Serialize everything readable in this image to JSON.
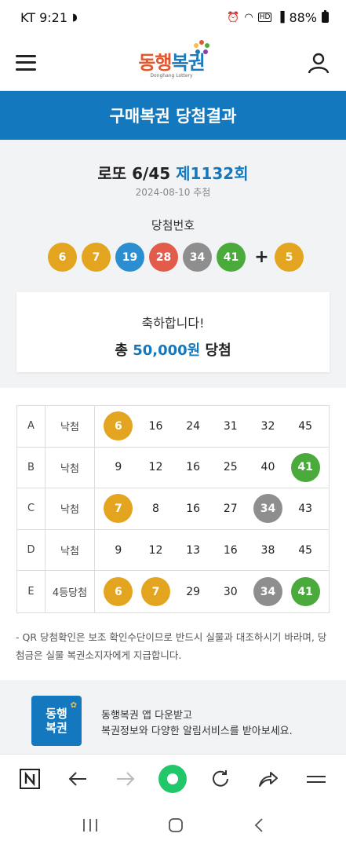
{
  "status_bar": {
    "carrier_time": "KT 9:21",
    "battery": "88%"
  },
  "header": {
    "logo_text_1": "동행",
    "logo_text_2": "복권",
    "logo_sub": "Donghang Lottery"
  },
  "title": "구매복권 당첨결과",
  "round": {
    "game": "로또 6/45",
    "round_no": "제1132회",
    "date": "2024-08-10 추첨"
  },
  "winning": {
    "label": "당첨번호",
    "numbers": [
      {
        "n": "6",
        "color": "#e3a520"
      },
      {
        "n": "7",
        "color": "#e3a520"
      },
      {
        "n": "19",
        "color": "#2b8ed0"
      },
      {
        "n": "28",
        "color": "#e25c4c"
      },
      {
        "n": "34",
        "color": "#8e8e8e"
      },
      {
        "n": "41",
        "color": "#4aaa3b"
      }
    ],
    "plus": "+",
    "bonus": {
      "n": "5",
      "color": "#e3a520"
    }
  },
  "congrats": {
    "line1": "축하합니다!",
    "prefix": "총",
    "amount": "50,000원",
    "suffix": "당첨"
  },
  "games": [
    {
      "letter": "A",
      "result": "낙첨",
      "nums": [
        "6",
        "16",
        "24",
        "31",
        "32",
        "45"
      ],
      "hits": [
        0
      ]
    },
    {
      "letter": "B",
      "result": "낙첨",
      "nums": [
        "9",
        "12",
        "16",
        "25",
        "40",
        "41"
      ],
      "hits": [
        5
      ]
    },
    {
      "letter": "C",
      "result": "낙첨",
      "nums": [
        "7",
        "8",
        "16",
        "27",
        "34",
        "43"
      ],
      "hits": [
        0,
        4
      ]
    },
    {
      "letter": "D",
      "result": "낙첨",
      "nums": [
        "9",
        "12",
        "13",
        "16",
        "38",
        "45"
      ],
      "hits": []
    },
    {
      "letter": "E",
      "result": "4등당첨",
      "nums": [
        "6",
        "7",
        "29",
        "30",
        "34",
        "41"
      ],
      "hits": [
        0,
        1,
        4,
        5
      ]
    }
  ],
  "notice": "- QR 당첨확인은 보조 확인수단이므로 반드시 실물과 대조하시기 바라며, 당첨금은 실물 복권소지자에게 지급합니다.",
  "promo": {
    "icon_line1": "동행",
    "icon_line2": "복권",
    "line1": "동행복권 앱 다운받고",
    "line2": "복권정보와 다양한 알림서비스를 받아보세요."
  },
  "toolbar": {
    "n_label": "N"
  },
  "colors": {
    "brand_blue": "#1478be",
    "home_green": "#22c76a"
  }
}
